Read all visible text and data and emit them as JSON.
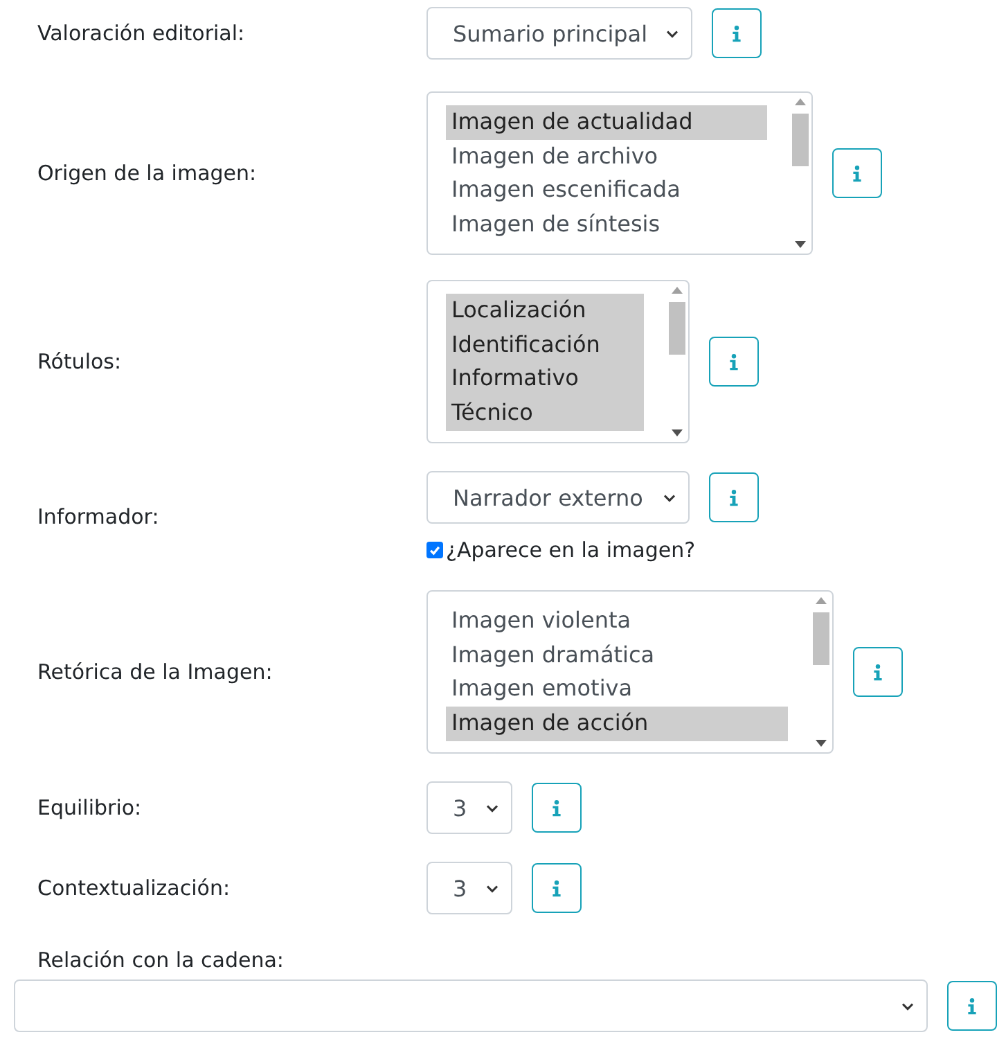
{
  "fields": [
    {
      "kind": "select",
      "label": "Valoración editorial:",
      "value": "Sumario principal"
    },
    {
      "kind": "listbox",
      "label": "Origen de la imagen:",
      "options": [
        {
          "text": "Imagen de actualidad",
          "selected": true
        },
        {
          "text": "Imagen de archivo",
          "selected": false
        },
        {
          "text": "Imagen escenificada",
          "selected": false
        },
        {
          "text": "Imagen de síntesis",
          "selected": false
        }
      ]
    },
    {
      "kind": "listbox",
      "label": "Rótulos:",
      "options": [
        {
          "text": "Localización",
          "selected": true
        },
        {
          "text": "Identificación",
          "selected": true
        },
        {
          "text": "Informativo",
          "selected": true
        },
        {
          "text": "Técnico",
          "selected": true
        }
      ]
    },
    {
      "kind": "select",
      "label": "Informador:",
      "value": "Narrador externo",
      "checkbox": {
        "label": "¿Aparece en la imagen?",
        "checked": true
      }
    },
    {
      "kind": "listbox",
      "label": "Retórica de la Imagen:",
      "options": [
        {
          "text": "Imagen violenta",
          "selected": false
        },
        {
          "text": "Imagen dramática",
          "selected": false
        },
        {
          "text": "Imagen emotiva",
          "selected": false
        },
        {
          "text": "Imagen de acción",
          "selected": true
        }
      ]
    },
    {
      "kind": "select",
      "label": "Equilibrio:",
      "value": "3"
    },
    {
      "kind": "select",
      "label": "Contextualización:",
      "value": "3"
    },
    {
      "kind": "wide-select",
      "label": "Relación con la cadena:"
    }
  ]
}
